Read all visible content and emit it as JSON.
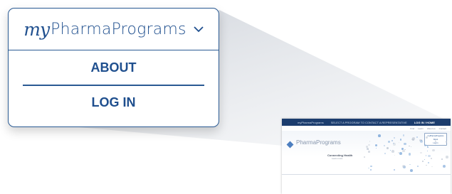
{
  "menu": {
    "logo_my": "my",
    "logo_name": "PharmaPrograms",
    "items": [
      {
        "label": "ABOUT"
      },
      {
        "label": "LOG IN"
      }
    ]
  },
  "thumbnail": {
    "top_links": [
      "myPharmaPrograms",
      "SELECT A PROGRAM TO CONTACT A REPRESENTATIVE",
      "LOG IN / HOME"
    ],
    "sub_links": [
      "Find",
      "Learn",
      "About us",
      "Contact"
    ],
    "brand": "PharmaPrograms",
    "headline": "Connecting Health",
    "subline": "Learn more",
    "panel_items": [
      "myPharmaPrograms",
      "About",
      "Log In"
    ]
  },
  "colors": {
    "brand_blue": "#1f4f8e",
    "border_blue": "#2a5a93",
    "nav_dark": "#1c3d6e",
    "beam_gray": "#d9dde3"
  }
}
